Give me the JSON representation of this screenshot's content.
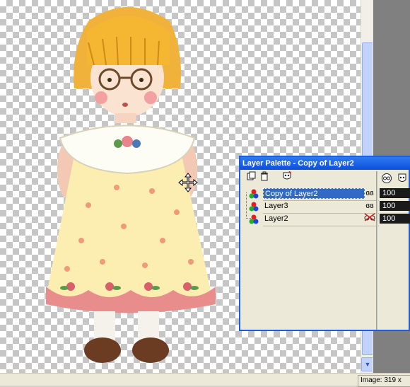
{
  "palette": {
    "title": "Layer Palette - Copy of Layer2",
    "layers": [
      {
        "name": "Copy of Layer2",
        "opacity": "100",
        "visible": true,
        "selected": true
      },
      {
        "name": "Layer3",
        "opacity": "100",
        "visible": true,
        "selected": false
      },
      {
        "name": "Layer2",
        "opacity": "100",
        "visible": false,
        "selected": false
      }
    ],
    "toolbar_icons": [
      "new-layer-icon",
      "delete-layer-icon",
      "layer-mask-icon"
    ]
  },
  "status": {
    "image_text": "Image:  319 x"
  },
  "colors": {
    "title_bar": "#0a4fd9",
    "selection": "#316ac5",
    "checker": "#c6c6c6"
  }
}
